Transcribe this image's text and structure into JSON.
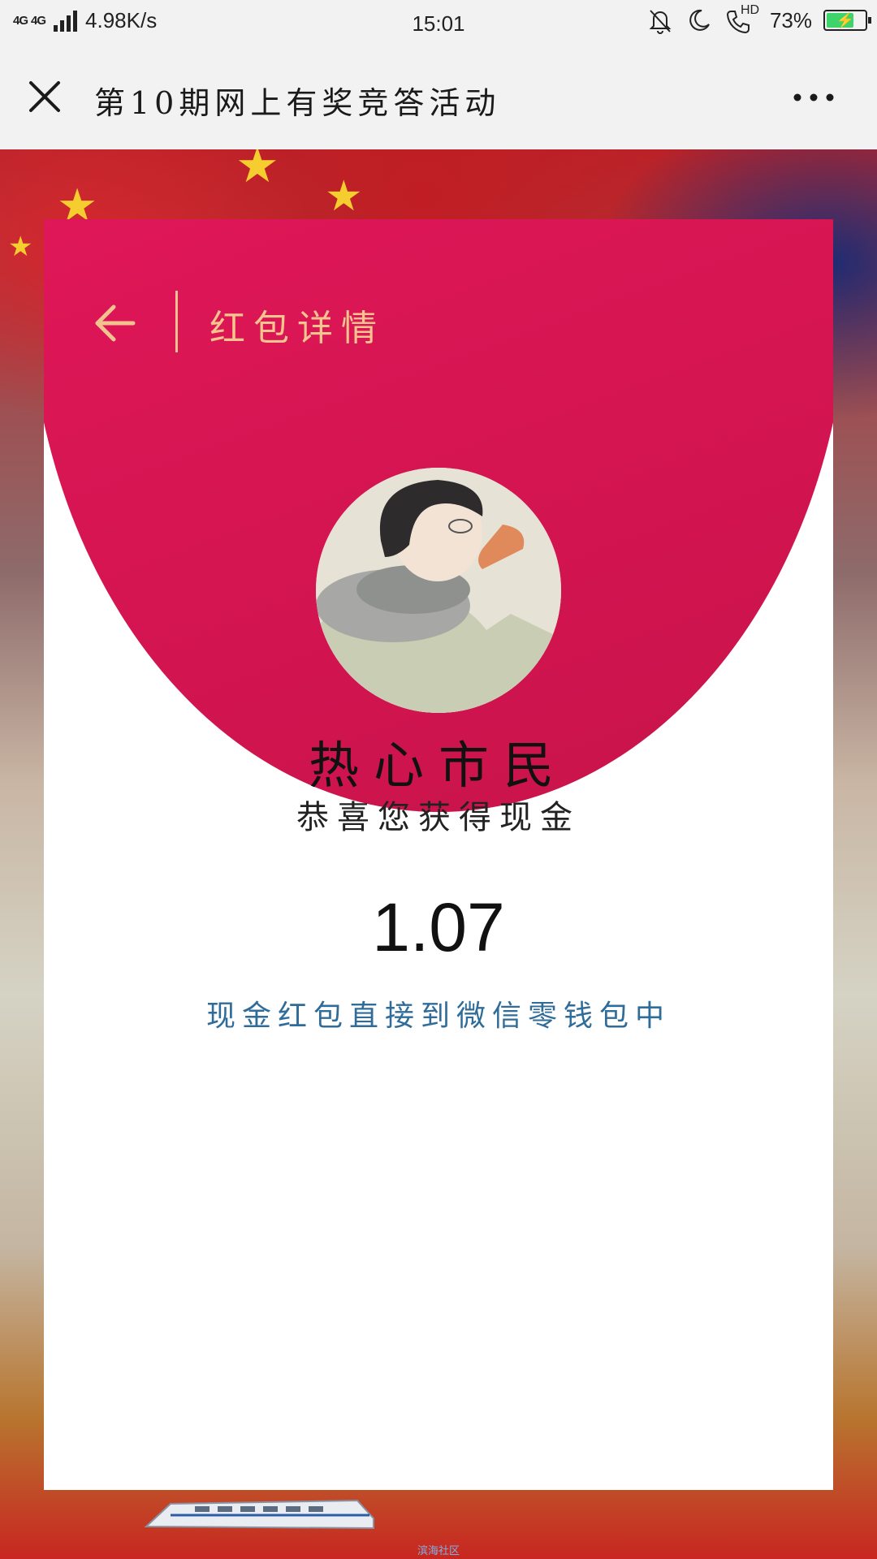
{
  "status_bar": {
    "network": "4G",
    "speed": "4.98K/s",
    "time": "15:01",
    "hd_label": "HD",
    "battery_percent": "73%",
    "battery_level": 0.73
  },
  "title_bar": {
    "title": "第10期网上有奖竞答活动"
  },
  "card": {
    "header_title": "红包详情",
    "name": "热心市民",
    "congrats": "恭喜您获得现金",
    "amount": "1.07",
    "note": "现金红包直接到微信零钱包中"
  },
  "footer": {
    "watermark": "滨海社区"
  },
  "colors": {
    "header_red": "#e0185a",
    "header_text": "#f6c48e",
    "note_blue": "#2f6c99",
    "battery_green": "#3fd36b"
  }
}
